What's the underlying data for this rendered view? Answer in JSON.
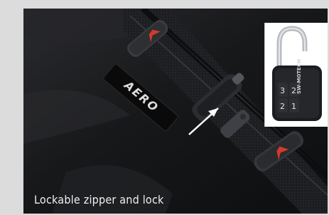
{
  "caption": "Lockable zipper and lock",
  "bag_label": "AERO",
  "lock_text": "SW-MOTECH",
  "colors": {
    "background": "#dcdcdc",
    "bag_fabric": "#1a1b1d",
    "accent_red": "#d23b2a",
    "caption_text": "#f0f0f0"
  },
  "icons": [
    "arrow-pointer-icon",
    "padlock-icon"
  ]
}
